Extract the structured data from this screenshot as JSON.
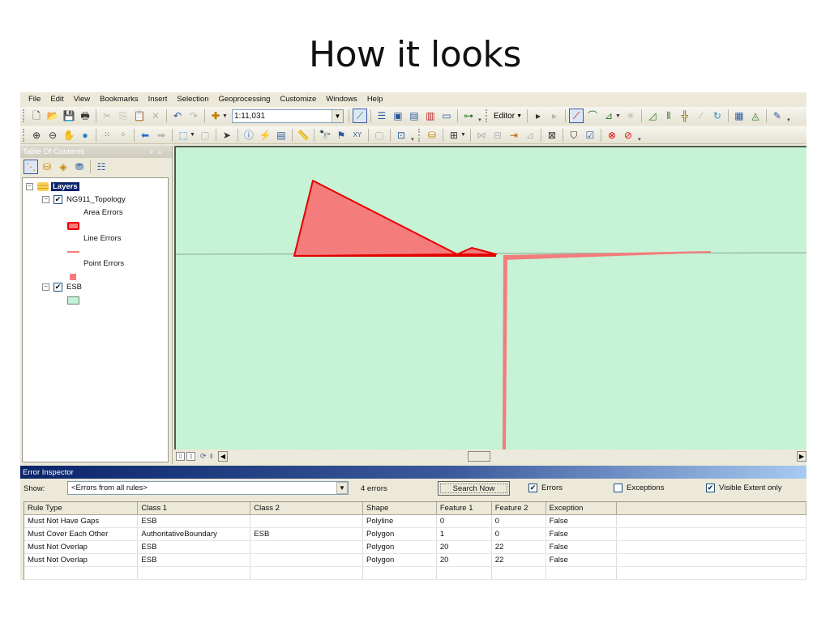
{
  "slide": {
    "title": "How it looks"
  },
  "menu": [
    "File",
    "Edit",
    "View",
    "Bookmarks",
    "Insert",
    "Selection",
    "Geoprocessing",
    "Customize",
    "Windows",
    "Help"
  ],
  "toolbar": {
    "scale_value": "1:11,031",
    "editor_label": "Editor",
    "icons_row1": [
      "new-document-icon",
      "open-folder-icon",
      "save-icon",
      "print-icon",
      "cut-icon",
      "copy-icon",
      "paste-icon",
      "delete-icon",
      "undo-icon",
      "redo-icon",
      "add-data-icon"
    ],
    "icons_row2": [
      "zoom-in-icon",
      "zoom-out-icon",
      "pan-icon",
      "full-extent-icon",
      "fixed-zoom-in-icon",
      "fixed-zoom-out-icon",
      "back-extent-icon",
      "forward-extent-icon",
      "select-features-icon",
      "clear-selection-icon",
      "select-elements-icon",
      "identify-icon",
      "hyperlink-icon",
      "html-popup-icon",
      "measure-icon",
      "find-icon",
      "find-route-icon",
      "go-to-xy-icon"
    ]
  },
  "toc": {
    "title": "Table Of Contents",
    "root_label": "Layers",
    "layers": [
      {
        "name": "NG911_Topology",
        "checked": true,
        "legend": [
          {
            "label": "Area Errors",
            "swatch": "area"
          },
          {
            "label": "Line Errors",
            "swatch": "line"
          },
          {
            "label": "Point Errors",
            "swatch": "point"
          }
        ]
      },
      {
        "name": "ESB",
        "checked": true,
        "legend": [
          {
            "label": "",
            "swatch": "esb"
          }
        ]
      }
    ]
  },
  "map": {
    "background_color": "#c6f2d6",
    "error_fill": "#f47c7c",
    "error_stroke": "#e60000"
  },
  "error_inspector": {
    "title": "Error Inspector",
    "show_label": "Show:",
    "show_value": "<Errors from all rules>",
    "error_count": "4 errors",
    "search_button": "Search Now",
    "checkboxes": {
      "errors": {
        "label": "Errors",
        "checked": true
      },
      "exceptions": {
        "label": "Exceptions",
        "checked": false
      },
      "visible_extent": {
        "label": "Visible Extent only",
        "checked": true
      }
    },
    "columns": [
      "Rule Type",
      "Class 1",
      "Class 2",
      "Shape",
      "Feature 1",
      "Feature 2",
      "Exception"
    ],
    "rows": [
      [
        "Must Not Have Gaps",
        "ESB",
        "",
        "Polyline",
        "0",
        "0",
        "False"
      ],
      [
        "Must Cover Each Other",
        "AuthoritativeBoundary",
        "ESB",
        "Polygon",
        "1",
        "0",
        "False"
      ],
      [
        "Must Not Overlap",
        "ESB",
        "",
        "Polygon",
        "20",
        "22",
        "False"
      ],
      [
        "Must Not Overlap",
        "ESB",
        "",
        "Polygon",
        "20",
        "22",
        "False"
      ]
    ]
  }
}
